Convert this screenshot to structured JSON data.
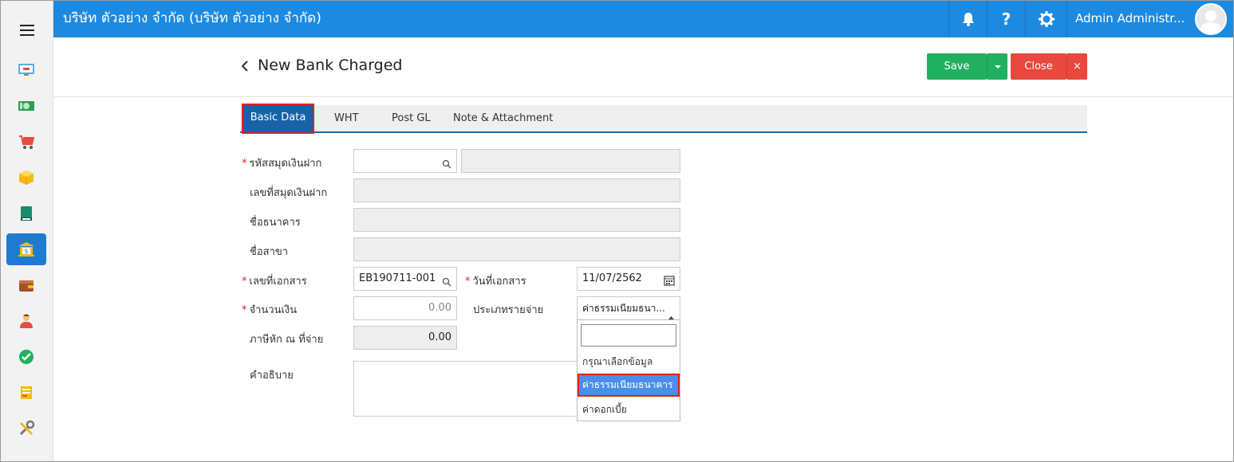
{
  "header": {
    "company": "บริษัท ตัวอย่าง จำกัด (บริษัท ตัวอย่าง จำกัด)",
    "user_name": "Admin Administr...",
    "icons": [
      "bell-icon",
      "help-icon",
      "gear-icon"
    ]
  },
  "sidebar": {
    "items": [
      {
        "icon": "dashboard-icon",
        "active": false
      },
      {
        "icon": "money-icon",
        "active": false
      },
      {
        "icon": "cart-icon",
        "active": false
      },
      {
        "icon": "box-icon",
        "active": false
      },
      {
        "icon": "book-icon",
        "active": false
      },
      {
        "icon": "bank-icon",
        "active": true
      },
      {
        "icon": "wallet-icon",
        "active": false
      },
      {
        "icon": "person-icon",
        "active": false
      },
      {
        "icon": "check-icon",
        "active": false
      },
      {
        "icon": "report-icon",
        "active": false
      },
      {
        "icon": "tools-icon",
        "active": false
      }
    ]
  },
  "page": {
    "title": "New Bank Charged",
    "save_label": "Save",
    "close_label": "Close",
    "close_x": "×"
  },
  "tabs": [
    {
      "label": "Basic Data",
      "active": true
    },
    {
      "label": "WHT",
      "active": false
    },
    {
      "label": "Post GL",
      "active": false
    },
    {
      "label": "Note & Attachment",
      "active": false
    }
  ],
  "form": {
    "bank_book_code_label": "รหัสสมุดเงินฝาก",
    "bank_book_code_value": "",
    "bank_book_name_value": "",
    "bank_book_no_label": "เลขที่สมุดเงินฝาก",
    "bank_name_label": "ชื่อธนาคาร",
    "branch_label": "ชื่อสาขา",
    "doc_no_label": "เลขที่เอกสาร",
    "doc_no_value": "EB190711-001",
    "doc_date_label": "วันที่เอกสาร",
    "doc_date_value": "11/07/2562",
    "amount_label": "จำนวนเงิน",
    "amount_value": "0.00",
    "expense_type_label": "ประเภทรายจ่าย",
    "expense_type_value": "ค่าธรรมเนียมธนา...",
    "wht_label": "ภาษีหัก ณ ที่จ่าย",
    "wht_value": "0.00",
    "description_label": "คำอธิบาย",
    "description_value": ""
  },
  "dropdown": {
    "search_value": "",
    "options": [
      {
        "label": "กรุณาเลือกข้อมูล",
        "selected": false
      },
      {
        "label": "ค่าธรรมเนียมธนาคาร",
        "selected": true
      },
      {
        "label": "ค่าดอกเบี้ย",
        "selected": false
      }
    ]
  },
  "colors": {
    "header": "#1d8ae0",
    "save": "#21b060",
    "close": "#e9483e",
    "tab_active": "#1863a8",
    "highlight": "#e02020"
  }
}
